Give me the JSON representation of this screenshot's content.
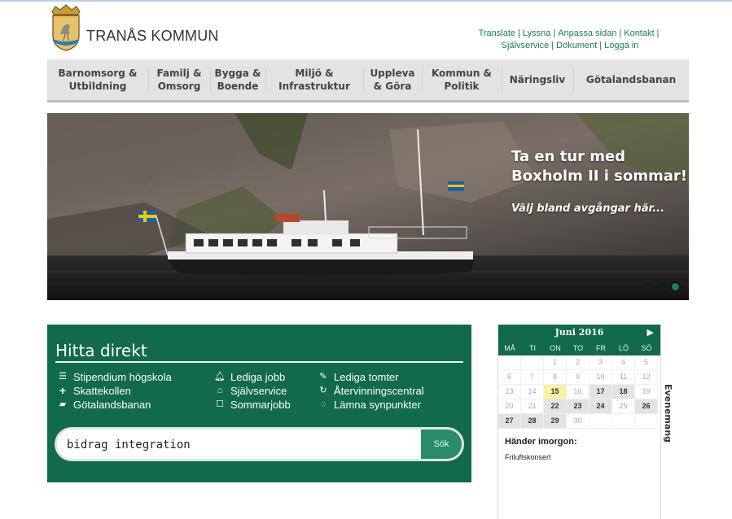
{
  "header": {
    "brand": "TRANÅS KOMMUN",
    "links_row1": [
      "Translate",
      "Lyssna",
      "Anpassa sidan",
      "Kontakt"
    ],
    "links_row2": [
      "Självservice",
      "Dokument",
      "Logga in"
    ]
  },
  "nav": {
    "items": [
      "Barnomsorg &\nUtbildning",
      "Familj &\nOmsorg",
      "Bygga &\nBoende",
      "Miljö &\nInfrastruktur",
      "Uppleva\n& Göra",
      "Kommun &\nPolitik",
      "Näringsliv",
      "Götalandsbanan"
    ]
  },
  "hero": {
    "title": "Ta en tur med\nBoxholm II i sommar!",
    "subtitle": "Välj bland avgångar här...",
    "slides_count": 3,
    "active_slide": 3
  },
  "hitta": {
    "title": "Hitta direkt",
    "col1": [
      {
        "icon": "list-icon",
        "label": "Stipendium högskola"
      },
      {
        "icon": "plus-icon",
        "label": "Skattekollen"
      },
      {
        "icon": "book-icon",
        "label": "Götalandsbanan"
      }
    ],
    "col2": [
      {
        "icon": "bell-icon",
        "label": "Lediga jobb"
      },
      {
        "icon": "home-icon",
        "label": "Självservice"
      },
      {
        "icon": "square-icon",
        "label": "Sommarjobb"
      }
    ],
    "col3": [
      {
        "icon": "edit-icon",
        "label": "Lediga tomter"
      },
      {
        "icon": "refresh-icon",
        "label": "Återvinningscentral"
      },
      {
        "icon": "comment-icon",
        "label": "Lämna synpunkter"
      }
    ],
    "search_value": "bidrag integration",
    "search_button": "Sök"
  },
  "calendar": {
    "month": "Juni 2016",
    "weekdays": [
      "MÅ",
      "TI",
      "ON",
      "TO",
      "FR",
      "LÖ",
      "SÖ"
    ],
    "weeks": [
      [
        "",
        "",
        "1",
        "2",
        "3",
        "4",
        "5"
      ],
      [
        "6",
        "7",
        "8",
        "9",
        "10",
        "11",
        "12"
      ],
      [
        "13",
        "14",
        "15",
        "16",
        "17",
        "18",
        "19"
      ],
      [
        "20",
        "21",
        "22",
        "23",
        "24",
        "25",
        "26"
      ],
      [
        "27",
        "28",
        "29",
        "30",
        "",
        "",
        ""
      ]
    ],
    "event_days": [
      "15",
      "17",
      "18",
      "22",
      "23",
      "24",
      "26",
      "27",
      "28",
      "29"
    ],
    "today": "15",
    "subheading": "Händer imorgon:",
    "event": "Friluftskonsert",
    "side_tab": "Evenemang"
  },
  "colors": {
    "brand_green": "#116a4c",
    "link_green": "#1e7a55",
    "nav_bg": "#e3e3e3"
  }
}
